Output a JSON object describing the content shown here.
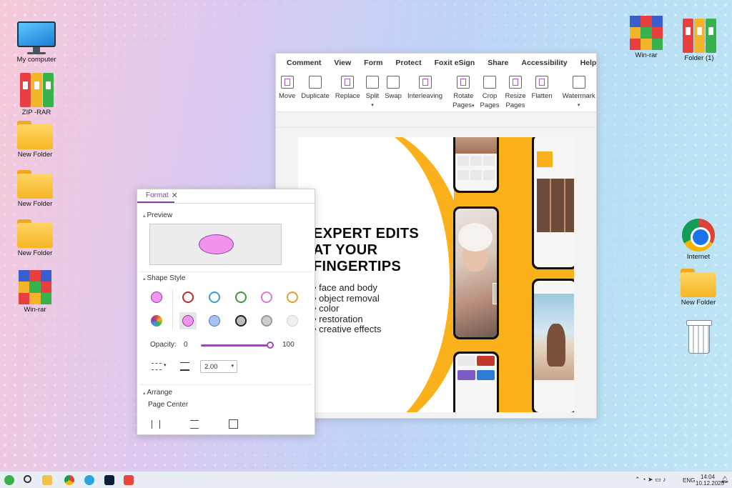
{
  "desktop": {
    "icons_left": [
      {
        "label": "My computer",
        "icon": "monitor-icon"
      },
      {
        "label": "ZIP -RAR",
        "icon": "binders-icon"
      },
      {
        "label": "New Folder",
        "icon": "folder-icon"
      },
      {
        "label": "New Folder",
        "icon": "folder-icon"
      },
      {
        "label": "New Folder",
        "icon": "folder-icon"
      },
      {
        "label": "Win-rar",
        "icon": "winrar-icon"
      }
    ],
    "icons_right": [
      {
        "label": "Win-rar",
        "icon": "winrar-icon"
      },
      {
        "label": "Folder (1)",
        "icon": "binders-icon"
      },
      {
        "label": "Internet",
        "icon": "chrome-icon"
      },
      {
        "label": "New Folder",
        "icon": "folder-icon"
      },
      {
        "label": "",
        "icon": "recycle-bin-icon"
      }
    ]
  },
  "app": {
    "menu": [
      "Comment",
      "View",
      "Form",
      "Protect",
      "Foxit eSign",
      "Share",
      "Accessibility",
      "Help"
    ],
    "ribbon": {
      "move": "Move",
      "duplicate": "Duplicate",
      "replace": "Replace",
      "split": "Split",
      "swap": "Swap",
      "interleaving": "Interleaving",
      "rotate_1": "Rotate",
      "rotate_2": "Pages",
      "crop_1": "Crop",
      "crop_2": "Pages",
      "resize_1": "Resize",
      "resize_2": "Pages",
      "flatten": "Flatten",
      "watermark": "Watermark"
    },
    "document": {
      "headline_1": "EXPERT EDITS",
      "headline_2": "AT YOUR",
      "headline_3": "FINGERTIPS",
      "bullets": [
        "face and body",
        "object removal",
        "color",
        "restoration",
        "creative effects"
      ],
      "accent_color": "#fbb11b"
    }
  },
  "format_panel": {
    "tab": "Format",
    "preview_label": "Preview",
    "shape_style_label": "Shape Style",
    "opacity_label": "Opacity:",
    "opacity_min": "0",
    "opacity_max": "100",
    "opacity_value": 1.0,
    "line_width": "2.00",
    "arrange_label": "Arrange",
    "page_center": "Page Center",
    "fill_color": "#f293ee",
    "stroke_color": "#8b3fa8"
  },
  "taskbar": {
    "language": "ENG",
    "time": "14:04",
    "date": "10.12.2025"
  }
}
